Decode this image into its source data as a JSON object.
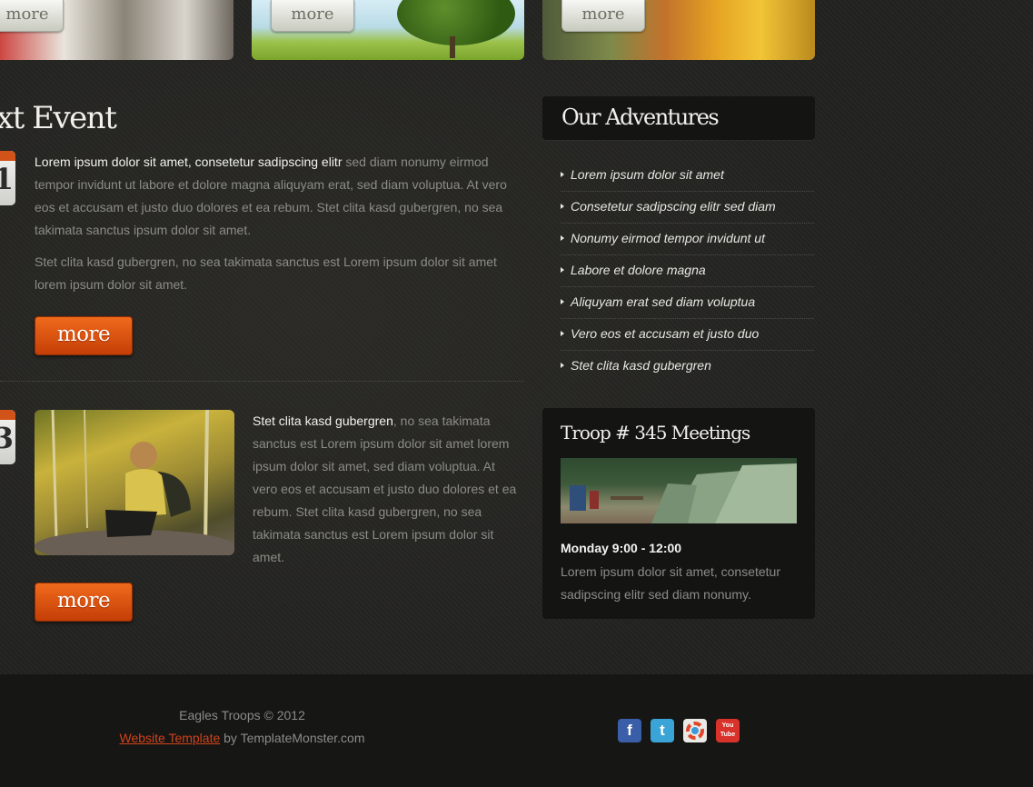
{
  "banner": {
    "more_label": "more"
  },
  "events": {
    "heading": "xt Event",
    "item1": {
      "day": "1",
      "lead": "Lorem ipsum dolor sit amet, consetetur sadipscing elitr",
      "text": " sed diam nonumy eirmod tempor invidunt ut labore et dolore magna aliquyam erat, sed diam voluptua. At vero eos et accusam et justo duo dolores et ea rebum. Stet clita kasd gubergren, no sea takimata sanctus ipsum dolor sit amet.",
      "text2": "Stet clita kasd gubergren, no sea takimata sanctus est Lorem ipsum dolor sit amet lorem ipsum dolor sit amet.",
      "more_label": "more"
    },
    "item2": {
      "day": "3",
      "lead": "Stet clita kasd gubergren",
      "text": ", no sea takimata sanctus est Lorem ipsum dolor sit amet lorem ipsum dolor sit amet, sed diam voluptua. At vero eos et accusam et justo duo dolores et ea rebum. Stet clita kasd gubergren, no sea takimata sanctus est Lorem ipsum dolor sit amet.",
      "more_label": "more"
    }
  },
  "adventures": {
    "heading": "Our Adventures",
    "items": [
      "Lorem ipsum dolor sit amet",
      "Consetetur sadipscing elitr sed diam",
      "Nonumy eirmod tempor invidunt ut",
      "Labore et dolore magna",
      "Aliquyam erat sed diam voluptua",
      "Vero eos et accusam et justo duo",
      "Stet clita kasd gubergren"
    ]
  },
  "meetings": {
    "heading": "Troop # 345 Meetings",
    "time": "Monday 9:00 - 12:00",
    "text": "Lorem ipsum dolor sit amet, consetetur sadipscing elitr sed diam nonumy."
  },
  "footer": {
    "copyright": "Eagles Troops © 2012",
    "link_label": "Website Template",
    "by_text": " by TemplateMonster.com",
    "social": [
      {
        "icon": "facebook-icon",
        "glyph": "f",
        "color": "#3b5ea8"
      },
      {
        "icon": "twitter-icon",
        "glyph": "t",
        "color": "#3aa4d6"
      },
      {
        "icon": "picasa-icon",
        "glyph": "",
        "color": "#e9e9e6"
      },
      {
        "icon": "youtube-icon",
        "glyph": "You Tube",
        "color": "#d8322a"
      }
    ]
  }
}
